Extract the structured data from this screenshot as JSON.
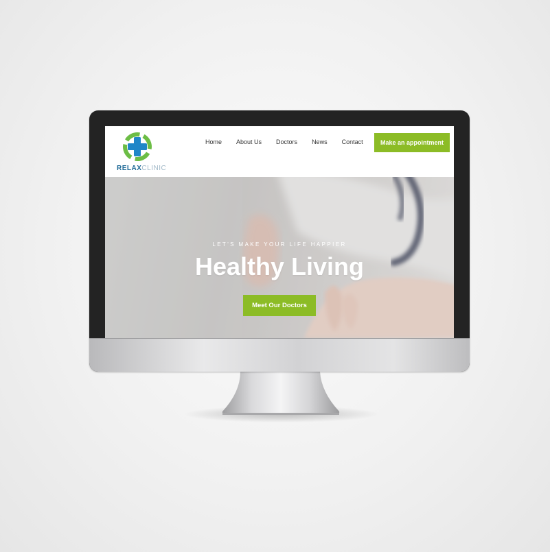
{
  "site": {
    "brand_part1": "RELAX",
    "brand_part2": "CLINIC",
    "logo_icon": "medical-cross-icon",
    "nav": [
      {
        "label": "Home"
      },
      {
        "label": "About Us"
      },
      {
        "label": "Doctors"
      },
      {
        "label": "News"
      },
      {
        "label": "Contact"
      }
    ],
    "cta_label": "Make an appointment"
  },
  "hero": {
    "kicker": "LET'S MAKE YOUR LIFE HAPPIER",
    "title": "Healthy Living",
    "button_label": "Meet Our Doctors"
  },
  "colors": {
    "accent": "#8cbc26",
    "logo_green": "#6cbd45",
    "logo_blue": "#1f86c8",
    "brand_dark": "#1f6a97",
    "bezel": "#232323"
  }
}
